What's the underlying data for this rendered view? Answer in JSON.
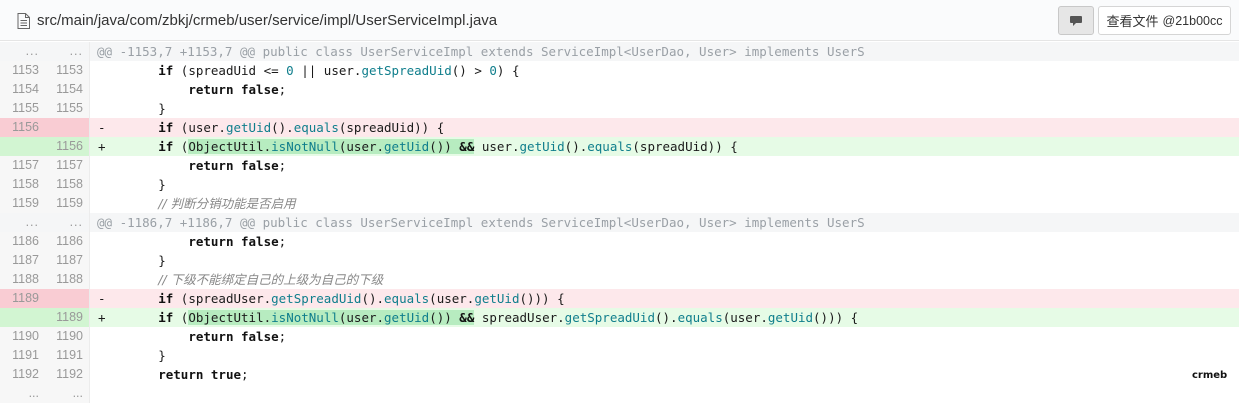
{
  "header": {
    "file_path": "src/main/java/com/zbkj/crmeb/user/service/impl/UserServiceImpl.java",
    "view_file_label": "查看文件",
    "commit_hash": "@21b00cc"
  },
  "diff": {
    "hunk1": "@@ -1153,7 +1153,7 @@ public class UserServiceImpl extends ServiceImpl<UserDao, User> implements UserS",
    "hunk2": "@@ -1186,7 +1186,7 @@ public class UserServiceImpl extends ServiceImpl<UserDao, User> implements UserS",
    "ellipsis": "...",
    "lines": {
      "l1153": {
        "old": "1153",
        "new": "1153"
      },
      "l1154": {
        "old": "1154",
        "new": "1154"
      },
      "l1155": {
        "old": "1155",
        "new": "1155"
      },
      "l1156d": {
        "old": "1156",
        "new": "",
        "sign": "-"
      },
      "l1156a": {
        "old": "",
        "new": "1156",
        "sign": "+"
      },
      "l1157": {
        "old": "1157",
        "new": "1157"
      },
      "l1158": {
        "old": "1158",
        "new": "1158"
      },
      "l1159": {
        "old": "1159",
        "new": "1159"
      },
      "l1186": {
        "old": "1186",
        "new": "1186"
      },
      "l1187": {
        "old": "1187",
        "new": "1187"
      },
      "l1188": {
        "old": "1188",
        "new": "1188"
      },
      "l1189d": {
        "old": "1189",
        "new": "",
        "sign": "-"
      },
      "l1189a": {
        "old": "",
        "new": "1189",
        "sign": "+"
      },
      "l1190": {
        "old": "1190",
        "new": "1190"
      },
      "l1191": {
        "old": "1191",
        "new": "1191"
      },
      "l1192": {
        "old": "1192",
        "new": "1192"
      }
    },
    "code": {
      "if": "if",
      "return": "return",
      "false": "false",
      "true": "true",
      "zero": "0",
      "c1153a": " (spreadUid <= ",
      "c1153b": " || user.",
      "c1153c": "getSpreadUid",
      "c1153d": "() > ",
      "c1153e": ") {",
      "c_false": ";",
      "c_brace": "}",
      "c1156d_a": " (user.",
      "getUid": "getUid",
      "equals": "equals",
      "isNotNull": "isNotNull",
      "getSpreadUid": "getSpreadUid",
      "c1156d_b": "().",
      "c1156d_c": "(spreadUid)) {",
      "c1156a_a": " (",
      "c1156a_b": "ObjectUtil.",
      "c1156a_c": "(user.",
      "c1156a_d": "())",
      "c1156a_e": " ",
      "and": "&&",
      "c1156a_f": " user.",
      "c1159": "// 判断分销功能是否启用",
      "c1188": "// 下级不能绑定自己的上级为自己的下级",
      "c1189d_a": " (spreadUser.",
      "c1189d_b": "().",
      "c1189d_c": "(user.",
      "c1189d_d": "())) {",
      "c1189a_f": " spreadUser."
    }
  },
  "watermark": "crmeb"
}
